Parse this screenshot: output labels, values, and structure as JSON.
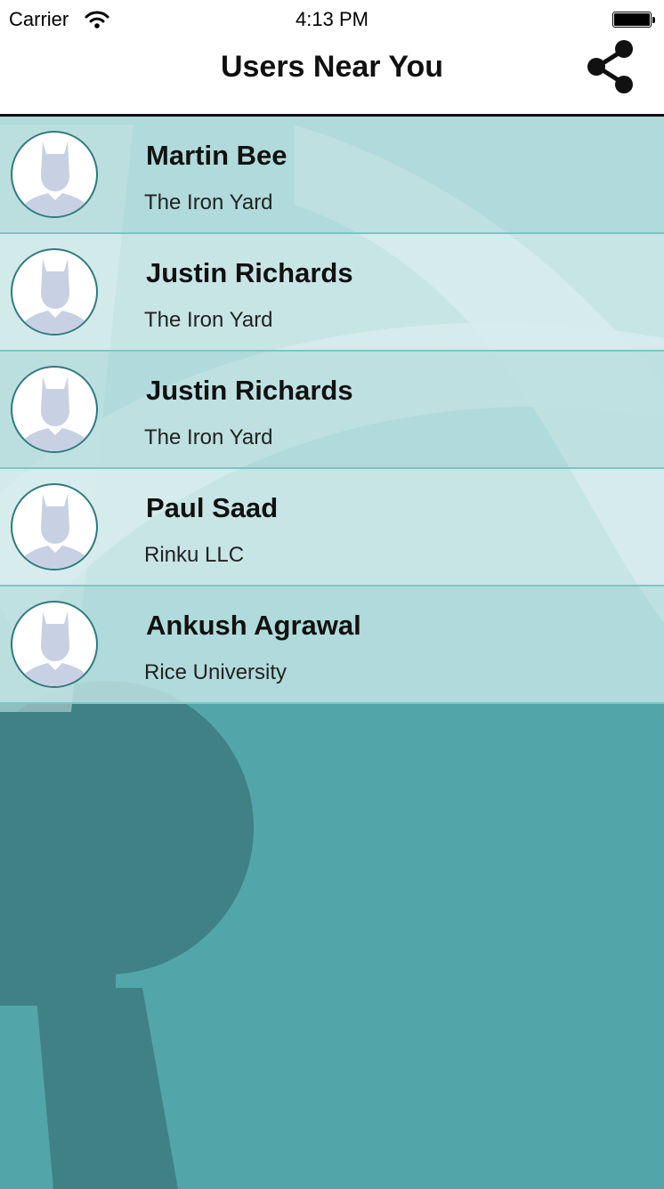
{
  "status_bar": {
    "carrier": "Carrier",
    "time": "4:13 PM"
  },
  "nav": {
    "title": "Users Near You",
    "share_icon": "share-icon"
  },
  "users": [
    {
      "name": "Martin Bee",
      "company": "The Iron Yard"
    },
    {
      "name": "Justin Richards",
      "company": "The Iron Yard"
    },
    {
      "name": "Justin Richards",
      "company": "The Iron Yard"
    },
    {
      "name": "Paul Saad",
      "company": "Rinku LLC"
    },
    {
      "name": "Ankush Agrawal",
      "company": "Rice University"
    }
  ],
  "colors": {
    "background_teal": "#52a6a9",
    "background_dark": "#3f8184",
    "row_dark": "#c4e5e5",
    "row_light": "#e2f3f3",
    "avatar_silhouette": "#c8d0e4"
  }
}
